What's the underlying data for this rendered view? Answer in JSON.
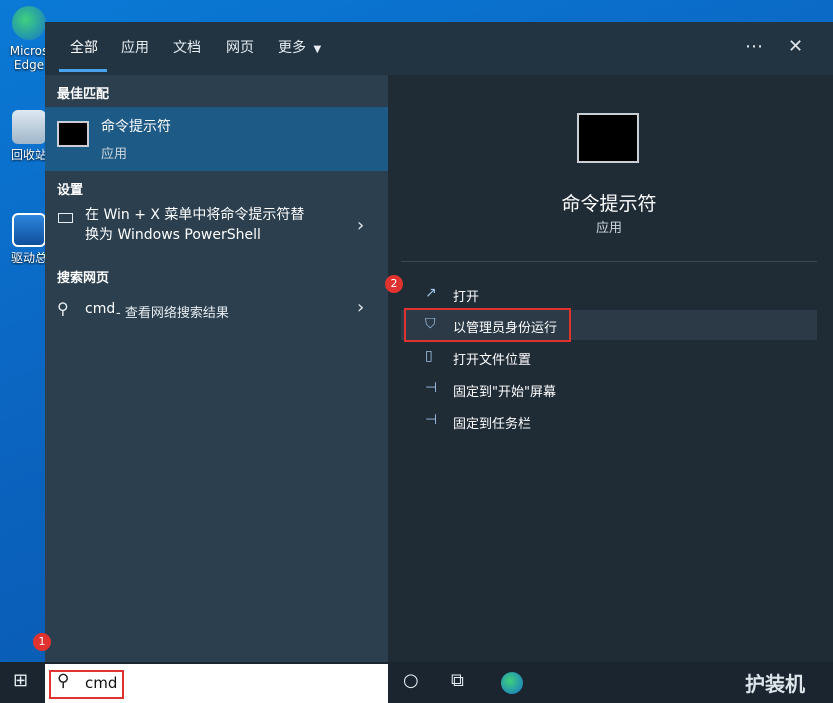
{
  "desktop": {
    "icons": [
      {
        "label": "Micros"
      },
      {
        "label": "Edge"
      },
      {
        "label": "回收站"
      },
      {
        "label": "驱动总"
      }
    ]
  },
  "tabs": [
    {
      "label": "全部"
    },
    {
      "label": "应用"
    },
    {
      "label": "文档"
    },
    {
      "label": "网页"
    },
    {
      "label": "更多"
    }
  ],
  "topbar": {
    "more_icon": "⋯",
    "close_icon": "✕"
  },
  "best_match": {
    "header": "最佳匹配",
    "title": "命令提示符",
    "subtitle": "应用"
  },
  "settings": {
    "header": "设置",
    "line1": "在 Win + X 菜单中将命令提示符替",
    "line2": "换为 Windows PowerShell"
  },
  "web_search": {
    "header": "搜索网页",
    "query": "cmd",
    "suffix": " - 查看网络搜索结果"
  },
  "preview": {
    "title": "命令提示符",
    "subtitle": "应用"
  },
  "actions": [
    {
      "label": "打开",
      "icon": "open-icon"
    },
    {
      "label": "以管理员身份运行",
      "icon": "shield-icon"
    },
    {
      "label": "打开文件位置",
      "icon": "folder-icon"
    },
    {
      "label": "固定到\"开始\"屏幕",
      "icon": "pin-icon"
    },
    {
      "label": "固定到任务栏",
      "icon": "pin-icon"
    }
  ],
  "search": {
    "value": "cmd"
  },
  "badges": {
    "one": "1",
    "two": "2"
  },
  "watermark": {
    "text": "护装机"
  },
  "colors": {
    "accent": "#4aa3ef",
    "highlight": "#e0332f",
    "selected_bg": "#1e5a86"
  }
}
